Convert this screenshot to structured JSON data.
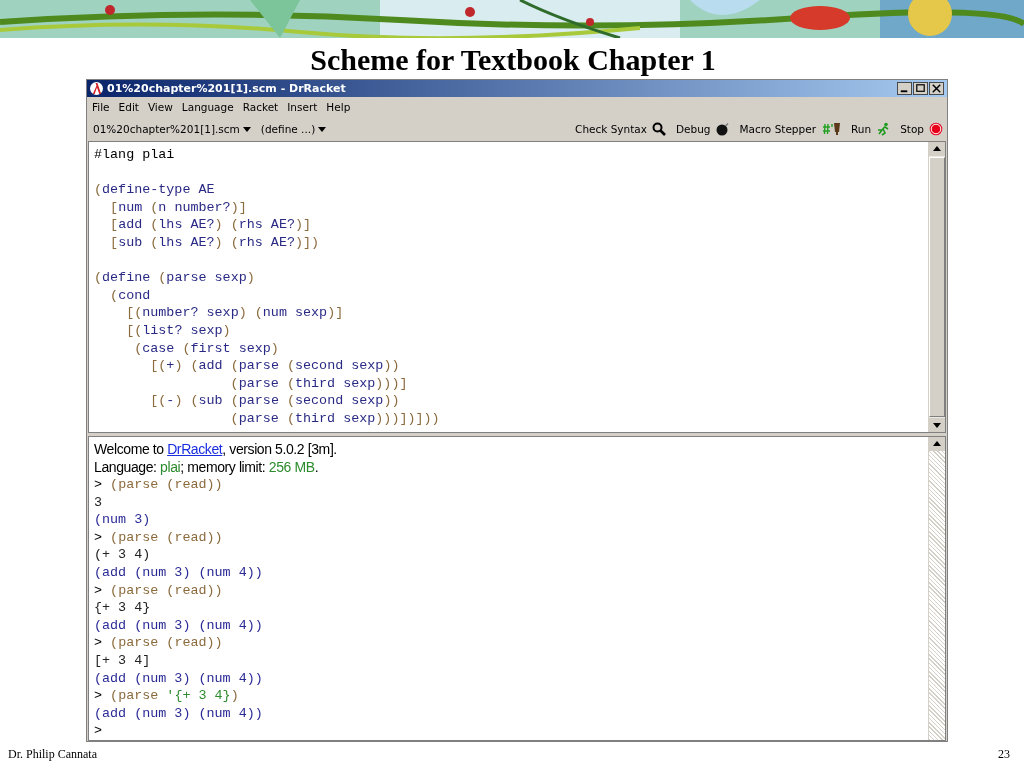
{
  "slide": {
    "title": "Scheme for Textbook Chapter 1",
    "footer_left": "Dr. Philip Cannata",
    "page_number": "23"
  },
  "window": {
    "title": "01%20chapter%201[1].scm - DrRacket",
    "menu": [
      "File",
      "Edit",
      "View",
      "Language",
      "Racket",
      "Insert",
      "Help"
    ],
    "dropdowns": [
      "01%20chapter%201[1].scm",
      "(define ...)"
    ],
    "toolbar": [
      {
        "label": "Check Syntax",
        "kind": "search"
      },
      {
        "label": "Debug",
        "kind": "bomb"
      },
      {
        "label": "Macro Stepper",
        "kind": "macro"
      },
      {
        "label": "Run",
        "kind": "run"
      },
      {
        "label": "Stop",
        "kind": "stop"
      }
    ],
    "editor": [
      {
        "lines": [
          {
            "text": "#lang plai",
            "kind": "plain"
          }
        ]
      },
      {
        "lines": [
          {
            "text": "(define-type AE",
            "kind": "code"
          },
          {
            "text": "  [num (n number?)]",
            "kind": "code"
          },
          {
            "text": "  [add (lhs AE?) (rhs AE?)]",
            "kind": "code"
          },
          {
            "text": "  [sub (lhs AE?) (rhs AE?)])",
            "kind": "code"
          }
        ]
      },
      {
        "lines": [
          {
            "text": "(define (parse sexp)",
            "kind": "code"
          },
          {
            "text": "  (cond",
            "kind": "code"
          },
          {
            "text": "    [(number? sexp) (num sexp)]",
            "kind": "code"
          },
          {
            "text": "    [(list? sexp)",
            "kind": "code"
          },
          {
            "text": "     (case (first sexp)",
            "kind": "code"
          },
          {
            "text": "       [(+) (add (parse (second sexp))",
            "kind": "code"
          },
          {
            "text": "                 (parse (third sexp)))]",
            "kind": "code"
          },
          {
            "text": "       [(-) (sub (parse (second sexp))",
            "kind": "code"
          },
          {
            "text": "                 (parse (third sexp)))])]))",
            "kind": "code"
          }
        ]
      }
    ],
    "welcome": [
      {
        "parts": [
          {
            "text": "Welcome to ",
            "kind": "plain"
          },
          {
            "text": "DrRacket",
            "kind": "link"
          },
          {
            "text": ", version 5.0.2 [3m].",
            "kind": "plain"
          }
        ]
      },
      {
        "parts": [
          {
            "text": "Language: ",
            "kind": "plain"
          },
          {
            "text": "plai",
            "kind": "value"
          },
          {
            "text": "; memory limit: ",
            "kind": "plain"
          },
          {
            "text": "256 MB",
            "kind": "value"
          },
          {
            "text": ".",
            "kind": "plain"
          }
        ]
      }
    ],
    "repl": [
      {
        "kind": "prompt",
        "prompt": ">",
        "parts": [
          {
            "text": "(parse (read))",
            "kind": "expr"
          }
        ]
      },
      {
        "kind": "input",
        "text": "3"
      },
      {
        "kind": "result",
        "text": "(num 3)"
      },
      {
        "kind": "prompt",
        "prompt": ">",
        "parts": [
          {
            "text": "(parse (read))",
            "kind": "expr"
          }
        ]
      },
      {
        "kind": "input",
        "text": "(+ 3 4)"
      },
      {
        "kind": "result",
        "text": "(add (num 3) (num 4))"
      },
      {
        "kind": "prompt",
        "prompt": ">",
        "parts": [
          {
            "text": "(parse (read))",
            "kind": "expr"
          }
        ]
      },
      {
        "kind": "input",
        "text": "{+ 3 4}"
      },
      {
        "kind": "result",
        "text": "(add (num 3) (num 4))"
      },
      {
        "kind": "prompt",
        "prompt": ">",
        "parts": [
          {
            "text": "(parse (read))",
            "kind": "expr"
          }
        ]
      },
      {
        "kind": "input",
        "text": "[+ 3 4]"
      },
      {
        "kind": "result",
        "text": "(add (num 3) (num 4))"
      },
      {
        "kind": "prompt",
        "prompt": ">",
        "parts": [
          {
            "text": "(parse ",
            "kind": "expr"
          },
          {
            "text": "'{+ 3 4}",
            "kind": "quoted"
          },
          {
            "text": ")",
            "kind": "expr"
          }
        ]
      },
      {
        "kind": "result",
        "text": "(add (num 3) (num 4))"
      },
      {
        "kind": "prompt",
        "prompt": ">"
      }
    ]
  }
}
